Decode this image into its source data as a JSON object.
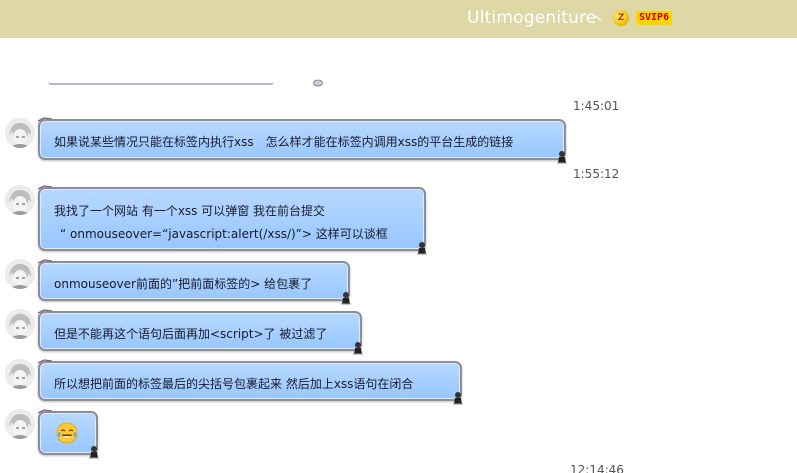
{
  "header": {
    "title": "Ultimogeniture",
    "tick": "丶",
    "level": "Z",
    "vip": "SVIP6"
  },
  "messages": [
    {
      "time": "1:45:01",
      "lines": [
        "如果说某些情况只能在标签内执行xss　怎么样才能在标签内调用xss的平台生成的链接"
      ]
    },
    {
      "time": "1:55:12",
      "lines": [
        "我找了一个网站  有一个xss 可以弹窗  我在前台提交",
        "“ onmouseover=“javascript:alert(/xss/)”> 这样可以谈框"
      ]
    },
    {
      "lines": [
        "onmouseover前面的”把前面标签的> 给包裹了"
      ]
    },
    {
      "lines": [
        "但是不能再这个语句后面再加<script>了 被过滤了"
      ]
    },
    {
      "lines": [
        "所以想把前面的标签最后的尖括号包裹起来  然后加上xss语句在闭合"
      ]
    },
    {
      "emoji": "tears-of-joy-emoji"
    }
  ],
  "footer_time": "12:14:46",
  "colors": {
    "header_bg": "#ddd8a6",
    "bubble": "#a9cfff",
    "vip": "#ffd400"
  }
}
